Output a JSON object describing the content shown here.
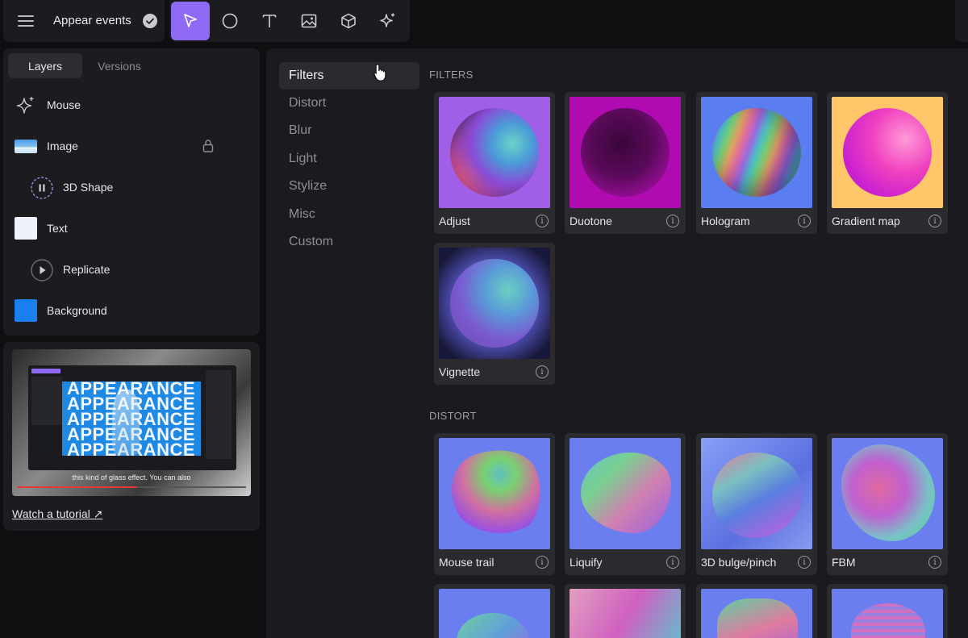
{
  "header": {
    "doc_title": "Appear events",
    "tools": [
      {
        "name": "select-tool",
        "icon": "cursor-arrow-icon",
        "active": true
      },
      {
        "name": "shape-tool",
        "icon": "circle-icon",
        "active": false
      },
      {
        "name": "text-tool",
        "icon": "text-t-icon",
        "active": false
      },
      {
        "name": "image-tool",
        "icon": "image-icon",
        "active": false
      },
      {
        "name": "3d-tool",
        "icon": "cube-icon",
        "active": false
      },
      {
        "name": "effect-tool",
        "icon": "sparkle-icon",
        "active": false
      }
    ]
  },
  "sidebar": {
    "tabs": [
      {
        "label": "Layers",
        "active": true
      },
      {
        "label": "Versions",
        "active": false
      }
    ],
    "layers": [
      {
        "label": "Mouse",
        "icon": "sparkle-icon"
      },
      {
        "label": "Image",
        "icon": "image-thumbnail-icon",
        "locked": true
      },
      {
        "label": "3D Shape",
        "icon": "pause-circle-icon"
      },
      {
        "label": "Text",
        "icon": "text-swatch-icon"
      },
      {
        "label": "Replicate",
        "icon": "play-circle-icon"
      },
      {
        "label": "Background",
        "icon": "blue-swatch-icon"
      }
    ]
  },
  "tutorial": {
    "video_words": [
      "APPEARANCE",
      "APPEARANCE",
      "APPEARANCE",
      "APPEARANCE",
      "APPEARANCE"
    ],
    "video_caption": "this kind of glass effect. You can also",
    "progress": 0.52,
    "link_label": "Watch a tutorial ↗"
  },
  "categories": [
    {
      "label": "Filters",
      "active": true
    },
    {
      "label": "Distort",
      "active": false
    },
    {
      "label": "Blur",
      "active": false
    },
    {
      "label": "Light",
      "active": false
    },
    {
      "label": "Stylize",
      "active": false
    },
    {
      "label": "Misc",
      "active": false
    },
    {
      "label": "Custom",
      "active": false
    }
  ],
  "sections": {
    "filters": {
      "title": "FILTERS",
      "items": [
        {
          "label": "Adjust"
        },
        {
          "label": "Duotone"
        },
        {
          "label": "Hologram"
        },
        {
          "label": "Gradient map"
        },
        {
          "label": "Vignette"
        }
      ]
    },
    "distort": {
      "title": "DISTORT",
      "items": [
        {
          "label": "Mouse trail"
        },
        {
          "label": "Liquify"
        },
        {
          "label": "3D bulge/pinch"
        },
        {
          "label": "FBM"
        }
      ]
    }
  },
  "colors": {
    "accent": "#8f6af5",
    "panel": "#1c1c20",
    "card": "#2a2a2f"
  }
}
